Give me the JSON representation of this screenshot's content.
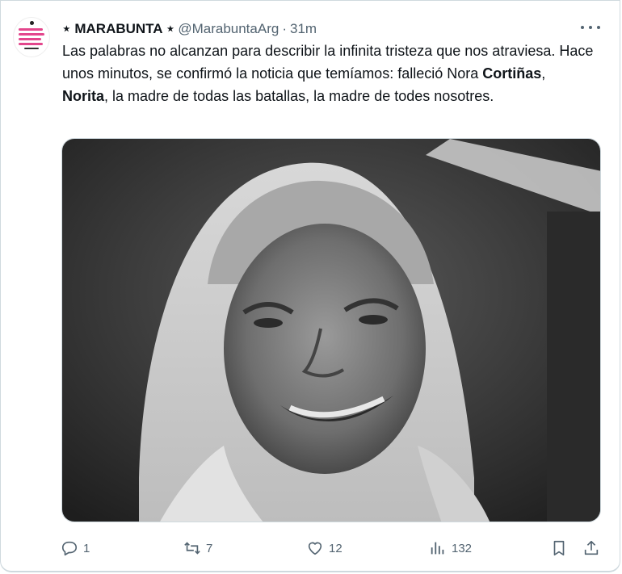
{
  "tweet": {
    "author": {
      "display_name": "⋆ MARABUNTA ⋆",
      "handle": "@MarabuntaArg",
      "separator": "·",
      "time": "31m",
      "avatar_icon": "avatar-logo-icon"
    },
    "text": {
      "part1": "Las palabras no alcanzan para describir la infinita tristeza que nos atraviesa. Hace unos minutos, se confirmó la noticia que temíamos: falleció Nora ",
      "bold1": "Cortiñas",
      "part2": ", ",
      "bold2": "Norita",
      "part3": ", la madre de todas las batallas, la madre de todes nosotres."
    },
    "more_icon": "more-dots-icon",
    "media": {
      "type": "photo",
      "tone": "black-and-white"
    },
    "actions": {
      "reply": {
        "icon": "reply-icon",
        "count": "1"
      },
      "retweet": {
        "icon": "retweet-icon",
        "count": "7"
      },
      "like": {
        "icon": "heart-icon",
        "count": "12"
      },
      "views": {
        "icon": "views-icon",
        "count": "132"
      },
      "bookmark": {
        "icon": "bookmark-icon"
      },
      "share": {
        "icon": "share-icon"
      }
    }
  }
}
